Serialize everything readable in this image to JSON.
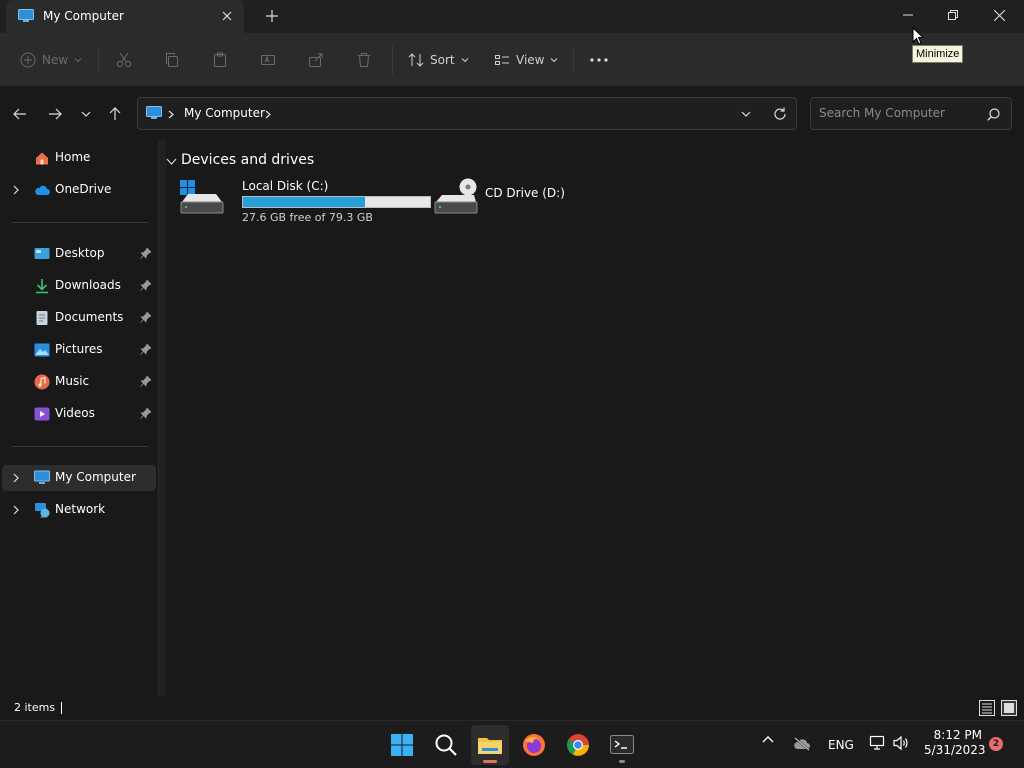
{
  "window": {
    "tab_title": "My Computer",
    "tooltip": "Minimize"
  },
  "command_bar": {
    "new_label": "New",
    "sort_label": "Sort",
    "view_label": "View"
  },
  "address_bar": {
    "location": "My Computer",
    "search_placeholder": "Search My Computer"
  },
  "sidebar": {
    "items": [
      {
        "label": "Home",
        "icon": "home-icon"
      },
      {
        "label": "OneDrive",
        "icon": "cloud-icon"
      },
      {
        "label": "Desktop",
        "icon": "desktop-icon"
      },
      {
        "label": "Downloads",
        "icon": "download-icon"
      },
      {
        "label": "Documents",
        "icon": "document-icon"
      },
      {
        "label": "Pictures",
        "icon": "picture-icon"
      },
      {
        "label": "Music",
        "icon": "music-icon"
      },
      {
        "label": "Videos",
        "icon": "video-icon"
      },
      {
        "label": "My Computer",
        "icon": "computer-icon"
      },
      {
        "label": "Network",
        "icon": "network-icon"
      }
    ]
  },
  "content": {
    "group_title": "Devices and drives",
    "drives": [
      {
        "name": "Local Disk (C:)",
        "free": "27.6 GB free of 79.3 GB",
        "used_fraction": 0.652
      },
      {
        "name": "CD Drive (D:)"
      }
    ]
  },
  "status": {
    "items_count": "2 items"
  },
  "taskbar": {
    "language": "ENG",
    "time": "8:12 PM",
    "date": "5/31/2023",
    "notification_count": "2"
  },
  "colors": {
    "accent": "#26a0da",
    "background": "#191919",
    "command_bar": "#2b2b2b"
  }
}
